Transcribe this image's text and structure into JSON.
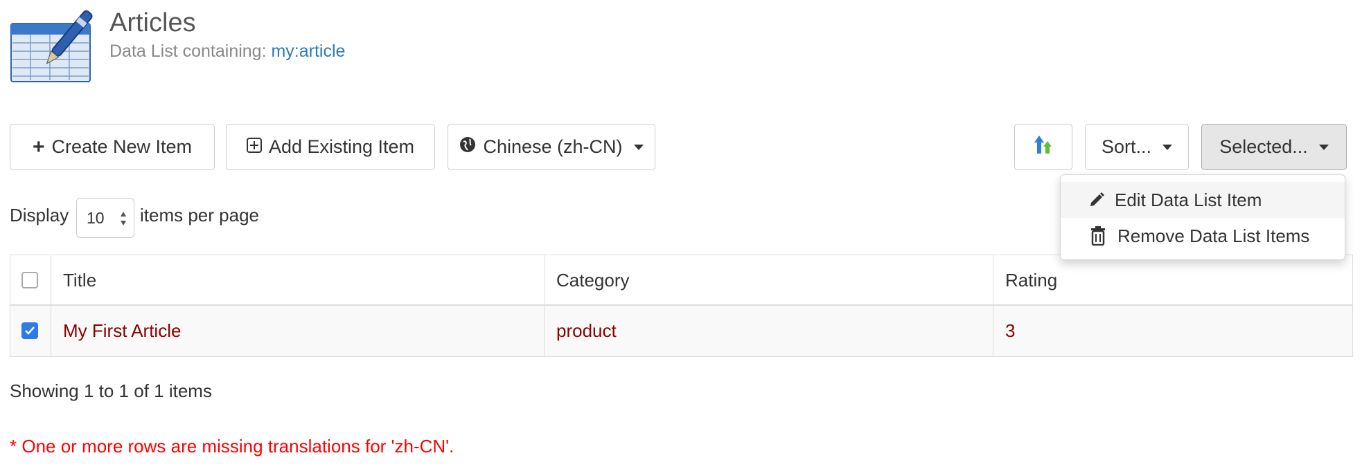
{
  "header": {
    "title": "Articles",
    "subtitle_prefix": "Data List containing:",
    "type_link": "my:article",
    "icon": "data-list-logo-icon"
  },
  "toolbar": {
    "create_label": "Create New Item",
    "add_existing_label": "Add Existing Item",
    "language_label": "Chinese (zh-CN)",
    "publish_icon": "publish-arrows-icon",
    "sort_label": "Sort...",
    "selected_label": "Selected..."
  },
  "selected_menu": {
    "items": [
      {
        "label": "Edit Data List Item",
        "icon": "pencil-icon"
      },
      {
        "label": "Remove Data List Items",
        "icon": "trash-icon"
      }
    ]
  },
  "pagination": {
    "display_label": "Display",
    "page_size": "10",
    "per_page_label": "items per page",
    "showing": "Showing 1 to 1 of 1 items"
  },
  "table": {
    "columns": [
      "Title",
      "Category",
      "Rating"
    ],
    "rows": [
      {
        "checked": true,
        "title": "My First Article",
        "category": "product",
        "rating": "3"
      }
    ]
  },
  "warning": "* One or more rows are missing translations for 'zh-CN'.",
  "colors": {
    "link": "#2a7ab8",
    "row_text": "#8b0000",
    "warning": "#ff0000",
    "checkbox": "#2d7be5"
  }
}
